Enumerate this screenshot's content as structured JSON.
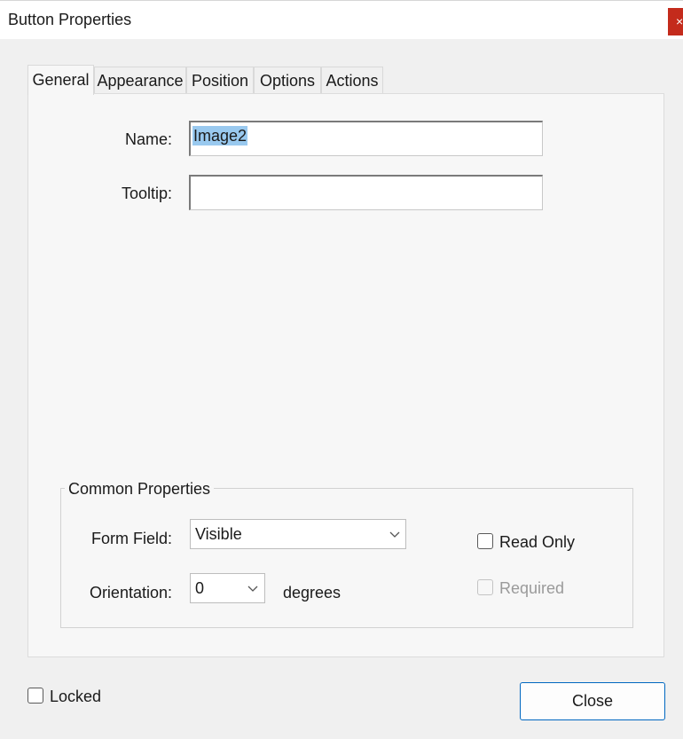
{
  "window": {
    "title": "Button Properties",
    "close_glyph": "×"
  },
  "tabs": [
    {
      "label": "General",
      "active": true
    },
    {
      "label": "Appearance",
      "active": false
    },
    {
      "label": "Position",
      "active": false
    },
    {
      "label": "Options",
      "active": false
    },
    {
      "label": "Actions",
      "active": false
    }
  ],
  "general": {
    "name_label": "Name:",
    "name_value": "Image2",
    "tooltip_label": "Tooltip:",
    "tooltip_value": ""
  },
  "common_properties": {
    "title": "Common Properties",
    "form_field_label": "Form Field:",
    "form_field_value": "Visible",
    "orientation_label": "Orientation:",
    "orientation_value": "0",
    "orientation_unit": "degrees",
    "read_only_label": "Read Only",
    "read_only_checked": false,
    "required_label": "Required",
    "required_checked": false,
    "required_enabled": false
  },
  "footer": {
    "locked_label": "Locked",
    "locked_checked": false,
    "close_label": "Close"
  },
  "colors": {
    "selection": "#99c9ef",
    "close_button_border": "#0067c0",
    "titlebar_close": "#c42b1c"
  }
}
